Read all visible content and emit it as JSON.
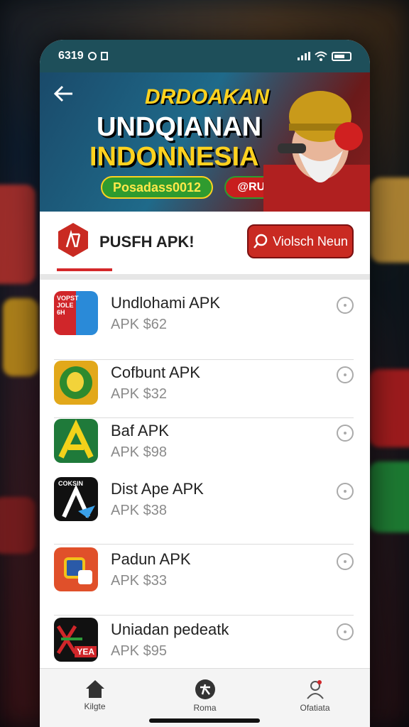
{
  "status_bar": {
    "time": "6319"
  },
  "banner": {
    "line1": "DRDOAKAN",
    "line2": "UNDQIANAN",
    "line3": "INDONNESIA",
    "pill_green": "Posadass0012",
    "pill_red": "@RUSKANIS"
  },
  "section": {
    "title": "PUSFH APK!",
    "search_label": "Violsch Neun"
  },
  "apps": [
    {
      "name": "Undlohami APK",
      "price": "APK $62",
      "icon_text": "VOPST JOLE 6H"
    },
    {
      "name": "Cofbunt APK",
      "price": "APK $32",
      "icon_text": ""
    },
    {
      "name": "Baf APK",
      "price": "APK $98",
      "icon_text": ""
    },
    {
      "name": "Dist Ape APK",
      "price": "APK $38",
      "icon_text": "COKSIN"
    },
    {
      "name": "Padun APK",
      "price": "APK $33",
      "icon_text": ""
    },
    {
      "name": "Uniadan pedeatk",
      "price": "APK $95",
      "icon_text": "YEA"
    }
  ],
  "nav": [
    {
      "label": "Kilgte",
      "icon": "home-icon"
    },
    {
      "label": "Roma",
      "icon": "apps-icon"
    },
    {
      "label": "Ofatiata",
      "icon": "profile-icon"
    }
  ]
}
